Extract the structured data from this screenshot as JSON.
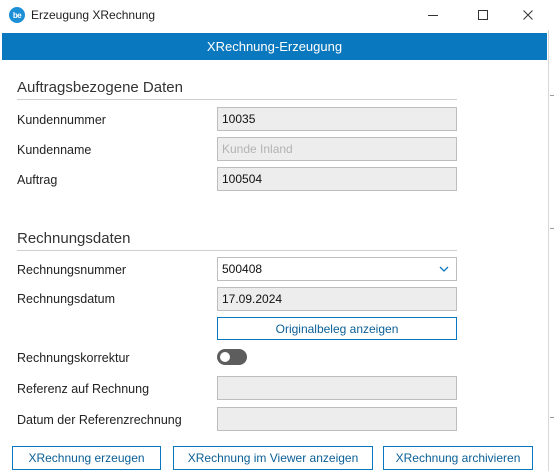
{
  "window": {
    "title": "Erzeugung XRechnung",
    "icon_text": "be",
    "controls": [
      "minimize-icon",
      "maximize-icon",
      "close-icon"
    ]
  },
  "banner": {
    "text": "XRechnung-Erzeugung",
    "color": "#0a78be"
  },
  "order_section": {
    "title": "Auftragsbezogene Daten",
    "customer_number_label": "Kundennummer",
    "customer_number_value": "10035",
    "customer_name_label": "Kundenname",
    "customer_name_value": "Kunde Inland",
    "order_label": "Auftrag",
    "order_value": "100504"
  },
  "invoice_section": {
    "title": "Rechnungsdaten",
    "invoice_number_label": "Rechnungsnummer",
    "invoice_number_value": "500408",
    "invoice_date_label": "Rechnungsdatum",
    "invoice_date_value": "17.09.2024",
    "show_original_button": "Originalbeleg anzeigen",
    "correction_label": "Rechnungskorrektur",
    "correction_enabled": false,
    "reference_label": "Referenz auf Rechnung",
    "reference_value": "",
    "reference_date_label": "Datum der Referenzrechnung",
    "reference_date_value": ""
  },
  "footer": {
    "create_button": "XRechnung erzeugen",
    "view_button": "XRechnung im Viewer anzeigen",
    "archive_button": "XRechnung archivieren"
  }
}
